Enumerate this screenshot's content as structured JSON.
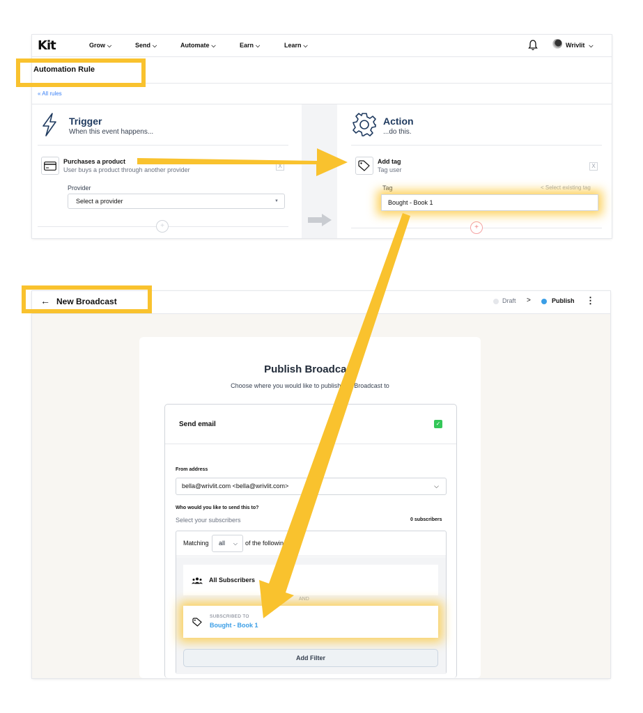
{
  "nav": {
    "logo": "Kit",
    "items": [
      {
        "label": "Grow"
      },
      {
        "label": "Send"
      },
      {
        "label": "Automate"
      },
      {
        "label": "Earn"
      },
      {
        "label": "Learn"
      }
    ],
    "chevron": "⌄",
    "user": "Wrivlit"
  },
  "rule": {
    "page_title": "Automation Rule",
    "back_link": "« All rules",
    "trigger": {
      "title": "Trigger",
      "subtitle": "When this event happens...",
      "item_title": "Purchases a product",
      "item_subtitle": "User buys a product through another provider",
      "provider_label": "Provider",
      "provider_placeholder": "Select a provider",
      "remove": "X",
      "add": "+"
    },
    "action": {
      "title": "Action",
      "subtitle": "...do this.",
      "item_title": "Add tag",
      "item_subtitle": "Tag user",
      "tag_label": "Tag",
      "select_existing": "< Select existing tag",
      "tag_value": "Bought - Book 1",
      "remove": "X",
      "add": "+"
    }
  },
  "broadcast": {
    "back": "←",
    "title": "New Broadcast",
    "steps": {
      "draft": "Draft",
      "separator": ">",
      "publish": "Publish"
    },
    "menu": "⋮",
    "publish_title": "Publish Broadcast",
    "publish_subtitle": "Choose where you would like to publish this Broadcast to",
    "send_email": "Send email",
    "send_email_checked": "✓",
    "from_label": "From address",
    "from_value": "bella@wrivlit.com <bella@wrivlit.com>",
    "to_label": "Who would you like to send this to?",
    "to_sub": "Select your subscribers",
    "subscriber_count": "0 subscribers",
    "matching": "Matching",
    "match_value": "all",
    "of_following": "of the following",
    "all_subscribers": "All Subscribers",
    "and": "AND",
    "subscribed_to_label": "SUBSCRIBED TO",
    "subscribed_to_value": "Bought - Book 1",
    "add_filter": "Add Filter"
  },
  "colors": {
    "highlight": "#f9c22e",
    "link_blue": "#3b9ee6",
    "check_green": "#34c759",
    "title_navy": "#1f3a5f"
  }
}
